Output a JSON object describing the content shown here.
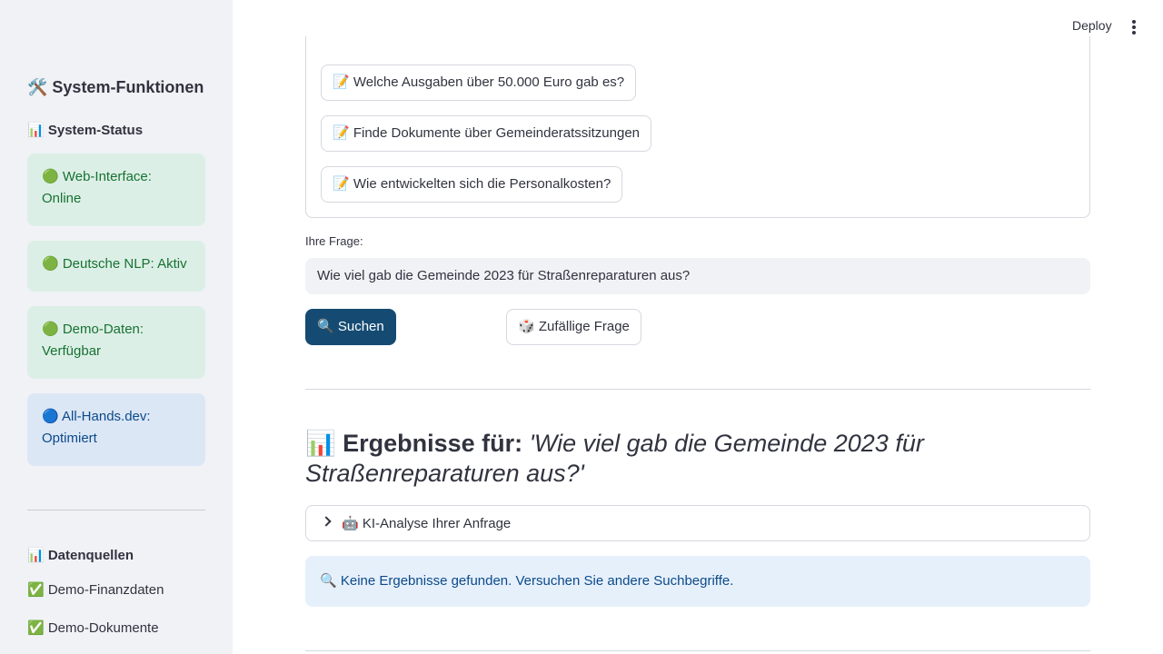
{
  "header": {
    "deploy_label": "Deploy",
    "menu_icon": "kebab-menu-icon"
  },
  "sidebar": {
    "title": "🛠️ System-Funktionen",
    "status_heading": "📊 System-Status",
    "status_items": [
      {
        "text": "🟢 Web-Interface: Online",
        "color": "#177233"
      },
      {
        "text": "🟢 Deutsche NLP: Aktiv",
        "color": "#177233"
      },
      {
        "text": "🟢 Demo-Daten: Verfügbar",
        "color": "#177233"
      },
      {
        "text": "🔵 All-Hands.dev: Optimiert",
        "color": "#0b4a8b"
      }
    ],
    "sources_heading": "📊 Datenquellen",
    "sources": [
      {
        "text": "✅ Demo-Finanzdaten"
      },
      {
        "text": "✅ Demo-Dokumente"
      }
    ]
  },
  "main": {
    "example_questions": [
      "📝 Welche Ausgaben über 50.000 Euro gab es?",
      "📝 Finde Dokumente über Gemeinderatssitzungen",
      "📝 Wie entwickelten sich die Personalkosten?"
    ],
    "question_label": "Ihre Frage:",
    "question_value": "Wie viel gab die Gemeinde 2023 für Straßenreparaturen aus?",
    "search_button": "🔍 Suchen",
    "random_button": "🎲 Zufällige Frage",
    "results_prefix": "📊 Ergebnisse für: ",
    "results_query": "'Wie viel gab die Gemeinde 2023 für Straßenreparaturen aus?'",
    "expander_label": "🤖 KI-Analyse Ihrer Anfrage",
    "info_message": "🔍 Keine Ergebnisse gefunden. Versuchen Sie andere Suchbegriffe."
  },
  "colors": {
    "primary_button": "#154b72",
    "sidebar_bg": "#f0f2f6",
    "success_bg": "#dcefe6",
    "info_bg": "#e6f0fb"
  }
}
